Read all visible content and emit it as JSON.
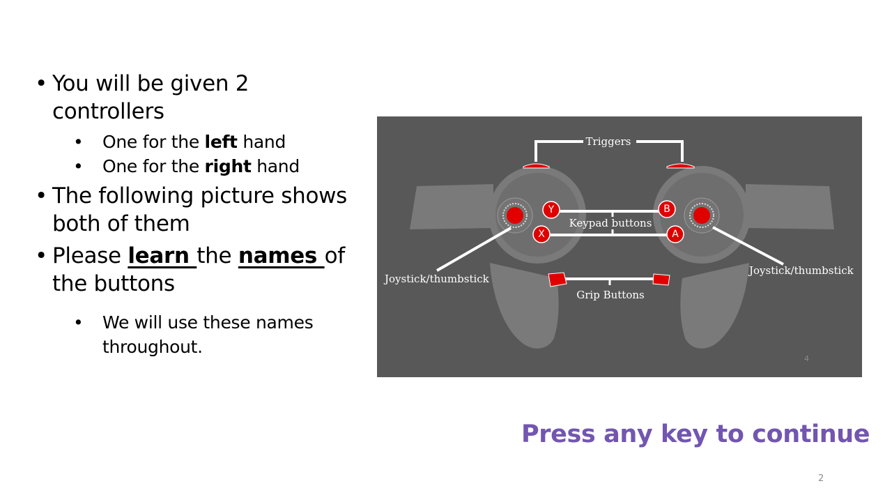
{
  "bullets": {
    "b1": "You will be given 2 controllers",
    "b1_sub1": {
      "pre": "One for the ",
      "bold": "left",
      "post": " hand"
    },
    "b1_sub2": {
      "pre": "One for the ",
      "bold": "right",
      "post": " hand"
    },
    "b2": "The following picture shows both of them",
    "b3": {
      "pre": "Please ",
      "learn": "learn ",
      "mid": "the ",
      "names": "names ",
      "post": "of the buttons"
    },
    "b3_sub1": "We will use these names throughout."
  },
  "figure": {
    "label_triggers": "Triggers",
    "label_keypad": "Keypad buttons",
    "label_joystick_left": "Joystick/thumbstick",
    "label_joystick_right": "Joystick/thumbstick",
    "label_grip": "Grip Buttons",
    "btn_y": "Y",
    "btn_b": "B",
    "btn_x": "X",
    "btn_a": "A",
    "inner_page_number": "4",
    "colors": {
      "background": "#585858",
      "controller": "#7a7a7a",
      "ring": "#6c6c6c",
      "buttons": "#e00000",
      "lines": "#ffffff"
    }
  },
  "continue_text": "Press any key to continue",
  "page_number": "2",
  "colors": {
    "accent": "#7256b0"
  }
}
